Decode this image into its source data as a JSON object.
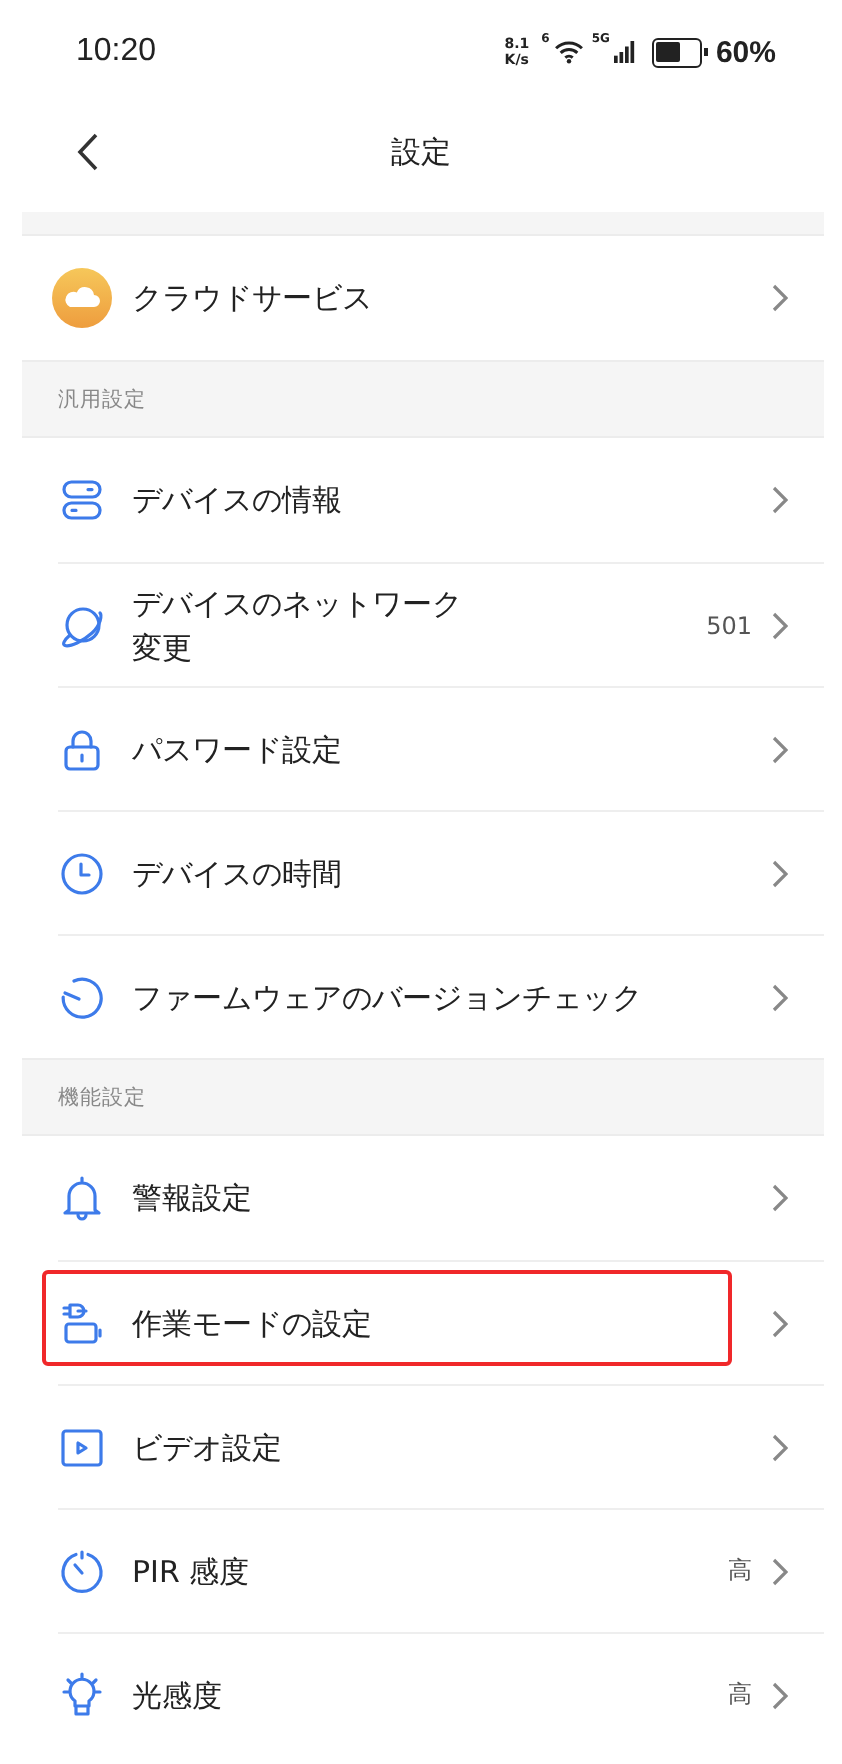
{
  "status_bar": {
    "time": "10:20",
    "speed_value": "8.1",
    "speed_unit": "K/s",
    "wifi_label": "6",
    "signal_label": "5G",
    "battery_text": "60%"
  },
  "nav": {
    "title": "設定"
  },
  "sections": [
    {
      "items": [
        {
          "label": "クラウドサービス",
          "highlighted": false
        }
      ]
    },
    {
      "header": "汎用設定",
      "items": [
        {
          "label": "デバイスの情報",
          "highlighted": false
        },
        {
          "label": "デバイスのネットワーク変更",
          "value": "501",
          "highlighted": false
        },
        {
          "label": "パスワード設定",
          "highlighted": false
        },
        {
          "label": "デバイスの時間",
          "highlighted": false
        },
        {
          "label": "ファームウェアのバージョンチェック",
          "highlighted": false
        }
      ]
    },
    {
      "header": "機能設定",
      "items": [
        {
          "label": "警報設定",
          "highlighted": false
        },
        {
          "label": "作業モードの設定",
          "highlighted": true
        },
        {
          "label": "ビデオ設定",
          "highlighted": false
        },
        {
          "label": "PIR 感度",
          "value": "高",
          "highlighted": false
        },
        {
          "label": "光感度",
          "value": "高",
          "highlighted": false
        }
      ]
    }
  ]
}
